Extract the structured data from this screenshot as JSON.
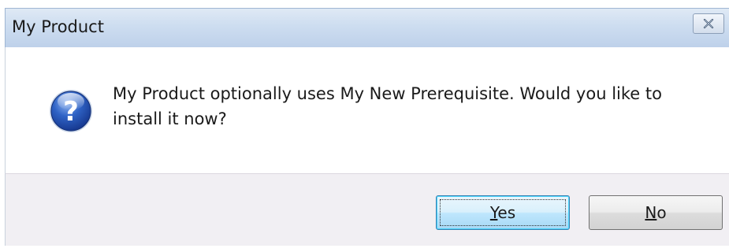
{
  "window": {
    "title": "My Product"
  },
  "message": {
    "text": "My Product optionally uses My New Prerequisite. Would you like to install it now?",
    "icon": "question-icon"
  },
  "buttons": {
    "yes": {
      "mnemonic": "Y",
      "rest": "es"
    },
    "no": {
      "mnemonic": "N",
      "rest": "o"
    }
  },
  "colors": {
    "titlebar": "#cdddf0",
    "footer": "#f1eff3",
    "default_button_border": "#3c7fb1",
    "icon_blue": "#1f4fa8"
  }
}
